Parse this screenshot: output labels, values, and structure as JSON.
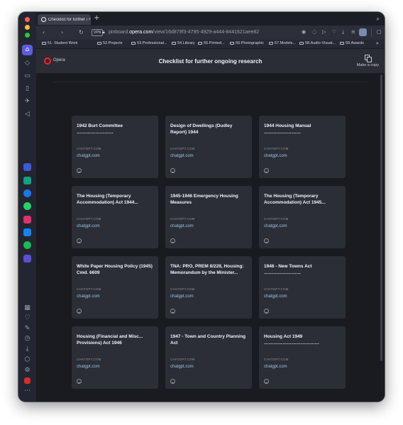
{
  "browser": {
    "tab_title": "Checklist for further ong",
    "tab_close": "×",
    "new_tab": "+",
    "url_prefix": "pinboard.",
    "url_domain": "opera.com",
    "url_path": "/view/16d879f3-4795-4929-a444-8441621aee82",
    "vpn_label": "VPN"
  },
  "bookmarks": [
    "51. Student Work",
    "52.Projects",
    "53.Professional...",
    "54.Library",
    "55.Printed...",
    "56.Photographic",
    "57.Models...",
    "58.Audio-Visual...",
    "59.Awards"
  ],
  "header": {
    "brand": "Opera",
    "title": "Checklist for further ongoing research",
    "copy_label": "Make a copy"
  },
  "cards": [
    {
      "title": "1942 Burt Committee ……………………",
      "domain": "CHATGPT.COM",
      "link": "chatgpt.com"
    },
    {
      "title": "Design of Dwellings (Dudley Report) 1944",
      "domain": "CHATGPT.COM",
      "link": "chatgpt.com"
    },
    {
      "title": "1944 Housing Manual ……………………",
      "domain": "CHATGPT.COM",
      "link": "chatgpt.com"
    },
    {
      "title": "The Housing (Temporary Accommodation) Act 1944...",
      "domain": "CHATGPT.COM",
      "link": "chatgpt.com"
    },
    {
      "title": "1945-1946 Emergency Housing Measures",
      "domain": "CHATGPT.COM",
      "link": "chatgpt.com"
    },
    {
      "title": "The Housing (Temporary Accommodation) Act 1945...",
      "domain": "CHATGPT.COM",
      "link": "chatgpt.com"
    },
    {
      "title": "White Paper Housing Policy (1945) Cmd. 6609",
      "domain": "CHATGPT.COM",
      "link": "chatgpt.com"
    },
    {
      "title": "TNA: PRO, PREM 8/228, Housing: Memorandum by the Minister...",
      "domain": "CHATGPT.COM",
      "link": "chatgpt.com"
    },
    {
      "title": "1946 - New Towns Act ……………………",
      "domain": "CHATGPT.COM",
      "link": "chatgpt.com"
    },
    {
      "title": "Housing (Financial and Misc... Provisions) Act 1946",
      "domain": "CHATGPT.COM",
      "link": "chatgpt.com"
    },
    {
      "title": "1947 - Town and Country Planning Act",
      "domain": "CHATGPT.COM",
      "link": "chatgpt.com"
    },
    {
      "title": "Housing Act 1949 ………………………………",
      "domain": "CHATGPT.COM",
      "link": "chatgpt.com"
    }
  ],
  "colors": {
    "accent": "#5b5be6",
    "opera_red": "#ff1b2d",
    "link": "#9cc3e8"
  }
}
